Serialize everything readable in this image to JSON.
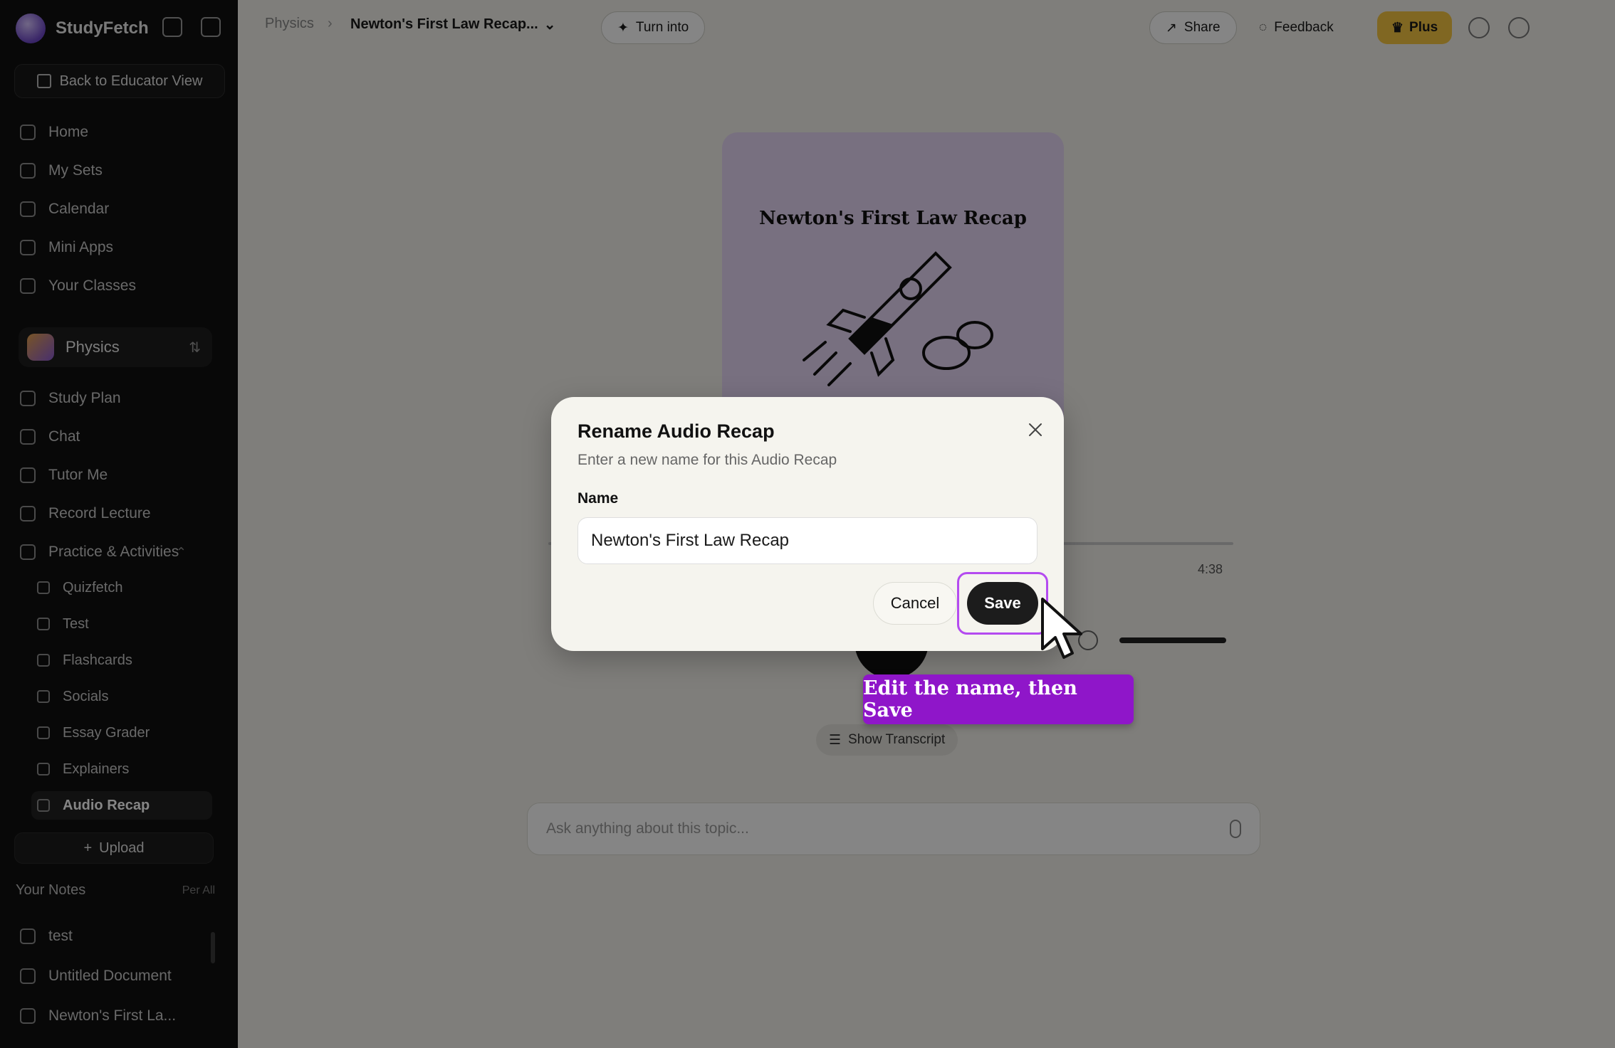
{
  "sidebar": {
    "brand": "StudyFetch",
    "back_button": "Back to Educator View",
    "nav": [
      "Home",
      "My Sets",
      "Calendar",
      "Mini Apps",
      "Your Classes"
    ],
    "class_name": "Physics",
    "class_nav": [
      "Study Plan",
      "Chat",
      "Tutor Me",
      "Record Lecture",
      "Practice & Activities"
    ],
    "practice_items": [
      "Quizfetch",
      "Test",
      "Flashcards",
      "Socials",
      "Essay Grader",
      "Explainers",
      "Audio Recap"
    ],
    "upload": "Upload",
    "notes_heading": "Your Notes",
    "notes_count": "Per All",
    "notes_items": [
      "test",
      "Untitled Document",
      "Newton's First La..."
    ]
  },
  "topbar": {
    "breadcrumb_root": "Physics",
    "breadcrumb_current": "Newton's First Law Recap...",
    "turn_into": "Turn into",
    "share": "Share",
    "feedback": "Feedback",
    "plus": "Plus"
  },
  "player": {
    "cover_title": "Newton's First Law Recap",
    "time_total": "4:38",
    "show_transcript": "Show Transcript",
    "ask_placeholder": "Ask anything about this topic..."
  },
  "modal": {
    "title": "Rename Audio Recap",
    "description": "Enter a new name for this Audio Recap",
    "name_label": "Name",
    "name_value": "Newton's First Law Recap",
    "cancel": "Cancel",
    "save": "Save"
  },
  "hint": {
    "text": "Edit the name, then Save"
  },
  "colors": {
    "accent": "#8f16c9",
    "ring": "#b44bf0",
    "plus": "#f5c542",
    "cover": "#e7d6f5"
  }
}
